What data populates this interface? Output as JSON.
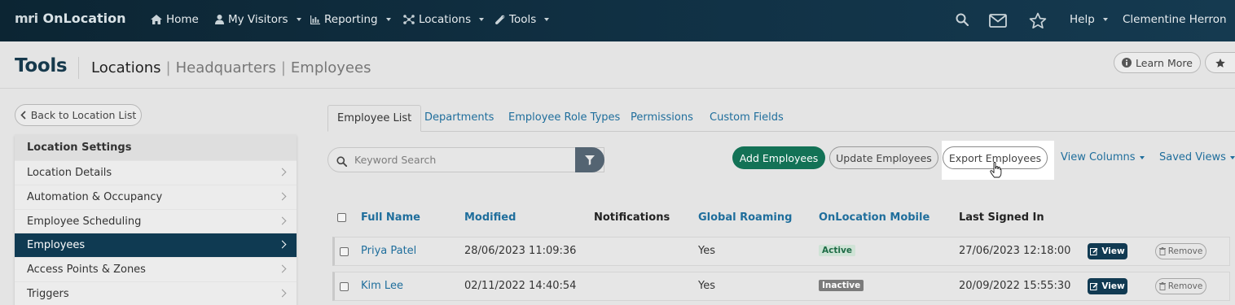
{
  "topnav": {
    "brand_mark": "mri",
    "brand_name": "OnLocation",
    "items": [
      {
        "label": "Home",
        "icon": "home-icon"
      },
      {
        "label": "My Visitors",
        "icon": "user-icon"
      },
      {
        "label": "Reporting",
        "icon": "bar-chart-icon"
      },
      {
        "label": "Locations",
        "icon": "network-icon"
      },
      {
        "label": "Tools",
        "icon": "wrench-icon"
      }
    ],
    "help": "Help",
    "user": "Clementine Herron"
  },
  "header": {
    "title": "Tools",
    "breadcrumb_current": "Locations",
    "breadcrumb_1": "Headquarters",
    "breadcrumb_2": "Employees",
    "learn_more": "Learn More"
  },
  "sidebar": {
    "back_label": "Back to Location List",
    "heading": "Location Settings",
    "items": [
      {
        "label": "Location Details"
      },
      {
        "label": "Automation & Occupancy"
      },
      {
        "label": "Employee Scheduling"
      },
      {
        "label": "Employees"
      },
      {
        "label": "Access Points & Zones"
      },
      {
        "label": "Triggers"
      }
    ],
    "active_item": "Employees"
  },
  "tabs": [
    "Employee List",
    "Departments",
    "Employee Role Types",
    "Permissions",
    "Custom Fields"
  ],
  "active_tab": "Employee List",
  "search": {
    "placeholder": "Keyword Search",
    "value": ""
  },
  "actions": {
    "add": "Add Employees",
    "update": "Update Employees",
    "export": "Export Employees",
    "view_columns": "View Columns",
    "saved_views": "Saved Views"
  },
  "table": {
    "headers": [
      "Full Name",
      "Modified",
      "Notifications",
      "Global Roaming",
      "OnLocation Mobile",
      "Last Signed In"
    ],
    "view_label": "View",
    "remove_label": "Remove",
    "rows": [
      {
        "name": "Priya Patel",
        "modified": "28/06/2023 11:09:36",
        "notifications": "",
        "global_roaming": "Yes",
        "mobile": "Active",
        "last_signed_in": "27/06/2023 12:18:00"
      },
      {
        "name": "Kim Lee",
        "modified": "02/11/2022 14:40:54",
        "notifications": "",
        "global_roaming": "Yes",
        "mobile": "Inactive",
        "last_signed_in": "20/09/2022 15:55:30"
      }
    ]
  },
  "colors": {
    "nav_bg": "#0f2f42",
    "primary_link": "#1f6e9c",
    "accent_green": "#137256",
    "active_sidebar": "#0f3a52"
  }
}
